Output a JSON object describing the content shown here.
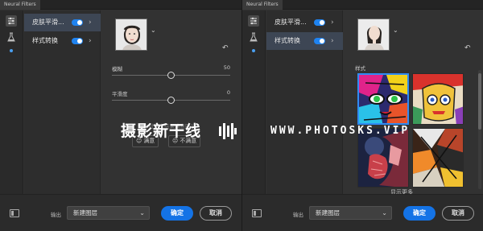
{
  "left_panel": {
    "tab_title": "Neural Filters",
    "filters": [
      {
        "label": "皮肤平滑...",
        "enabled": true,
        "selected": true
      },
      {
        "label": "样式转换",
        "enabled": true,
        "selected": false
      }
    ],
    "sliders": [
      {
        "label": "模糊",
        "value": "50",
        "fraction": 0.5
      },
      {
        "label": "平滑度",
        "value": "0",
        "fraction": 0.5
      }
    ],
    "feedback_prompt": "你对这个结果满意吗?",
    "feedback_buttons": [
      {
        "label": "满意"
      },
      {
        "label": "不满意"
      }
    ],
    "footer": {
      "output_label": "输出",
      "output_value": "新建图层",
      "ok_label": "确定",
      "cancel_label": "取消"
    }
  },
  "right_panel": {
    "tab_title": "Neural Filters",
    "filters": [
      {
        "label": "皮肤平滑...",
        "enabled": true,
        "selected": false
      },
      {
        "label": "样式转换",
        "enabled": true,
        "selected": true
      }
    ],
    "style_section_label": "样式",
    "show_more_label": "显示更多",
    "footer": {
      "output_label": "输出",
      "output_value": "新建图层",
      "ok_label": "确定",
      "cancel_label": "取消"
    }
  },
  "watermark": {
    "chinese_text": "摄影新干线",
    "url_text": "WWW.PHOTOSKS.VIP"
  },
  "colors": {
    "accent": "#1473e6",
    "toggle_on": "#1f83f0",
    "selected_row": "#3d4654",
    "panel_bg": "#323232"
  }
}
